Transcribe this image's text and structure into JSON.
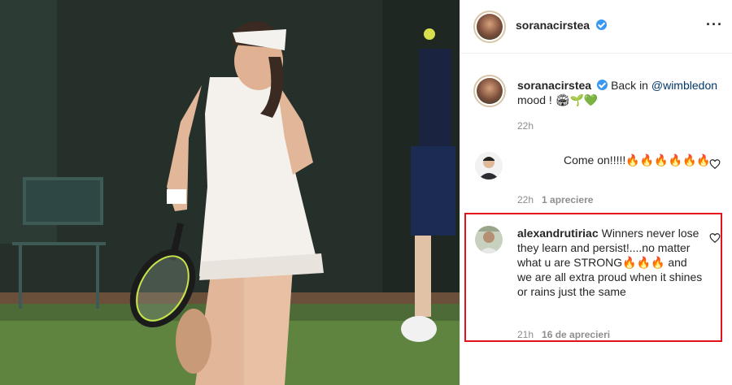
{
  "post": {
    "author": "soranacirstea",
    "verified": true
  },
  "caption": {
    "username": "soranacirstea",
    "text_prefix": "Back in ",
    "mention": "@wimbledon",
    "text_suffix": " mood ! ",
    "emojis": "🏟🌱💚",
    "time": "22h"
  },
  "comments": [
    {
      "username": "",
      "text": "Come on!!!!!🔥🔥🔥🔥🔥🔥",
      "time": "22h",
      "likes": "1 apreciere"
    },
    {
      "username": "alexandrutiriac",
      "text": "Winners never lose they learn and persist!....no matter what u are STRONG🔥🔥🔥 and we are all extra proud when it shines or rains just the same",
      "time": "21h",
      "likes": "16 de aprecieri"
    }
  ],
  "icons": {
    "more": "more-options-icon",
    "like": "heart-icon",
    "verified": "verified-badge-icon"
  },
  "colors": {
    "highlight_border": "#e3111b",
    "verified_blue": "#3897f0",
    "meta_gray": "#8e8e8e",
    "mention_blue": "#00376b"
  }
}
